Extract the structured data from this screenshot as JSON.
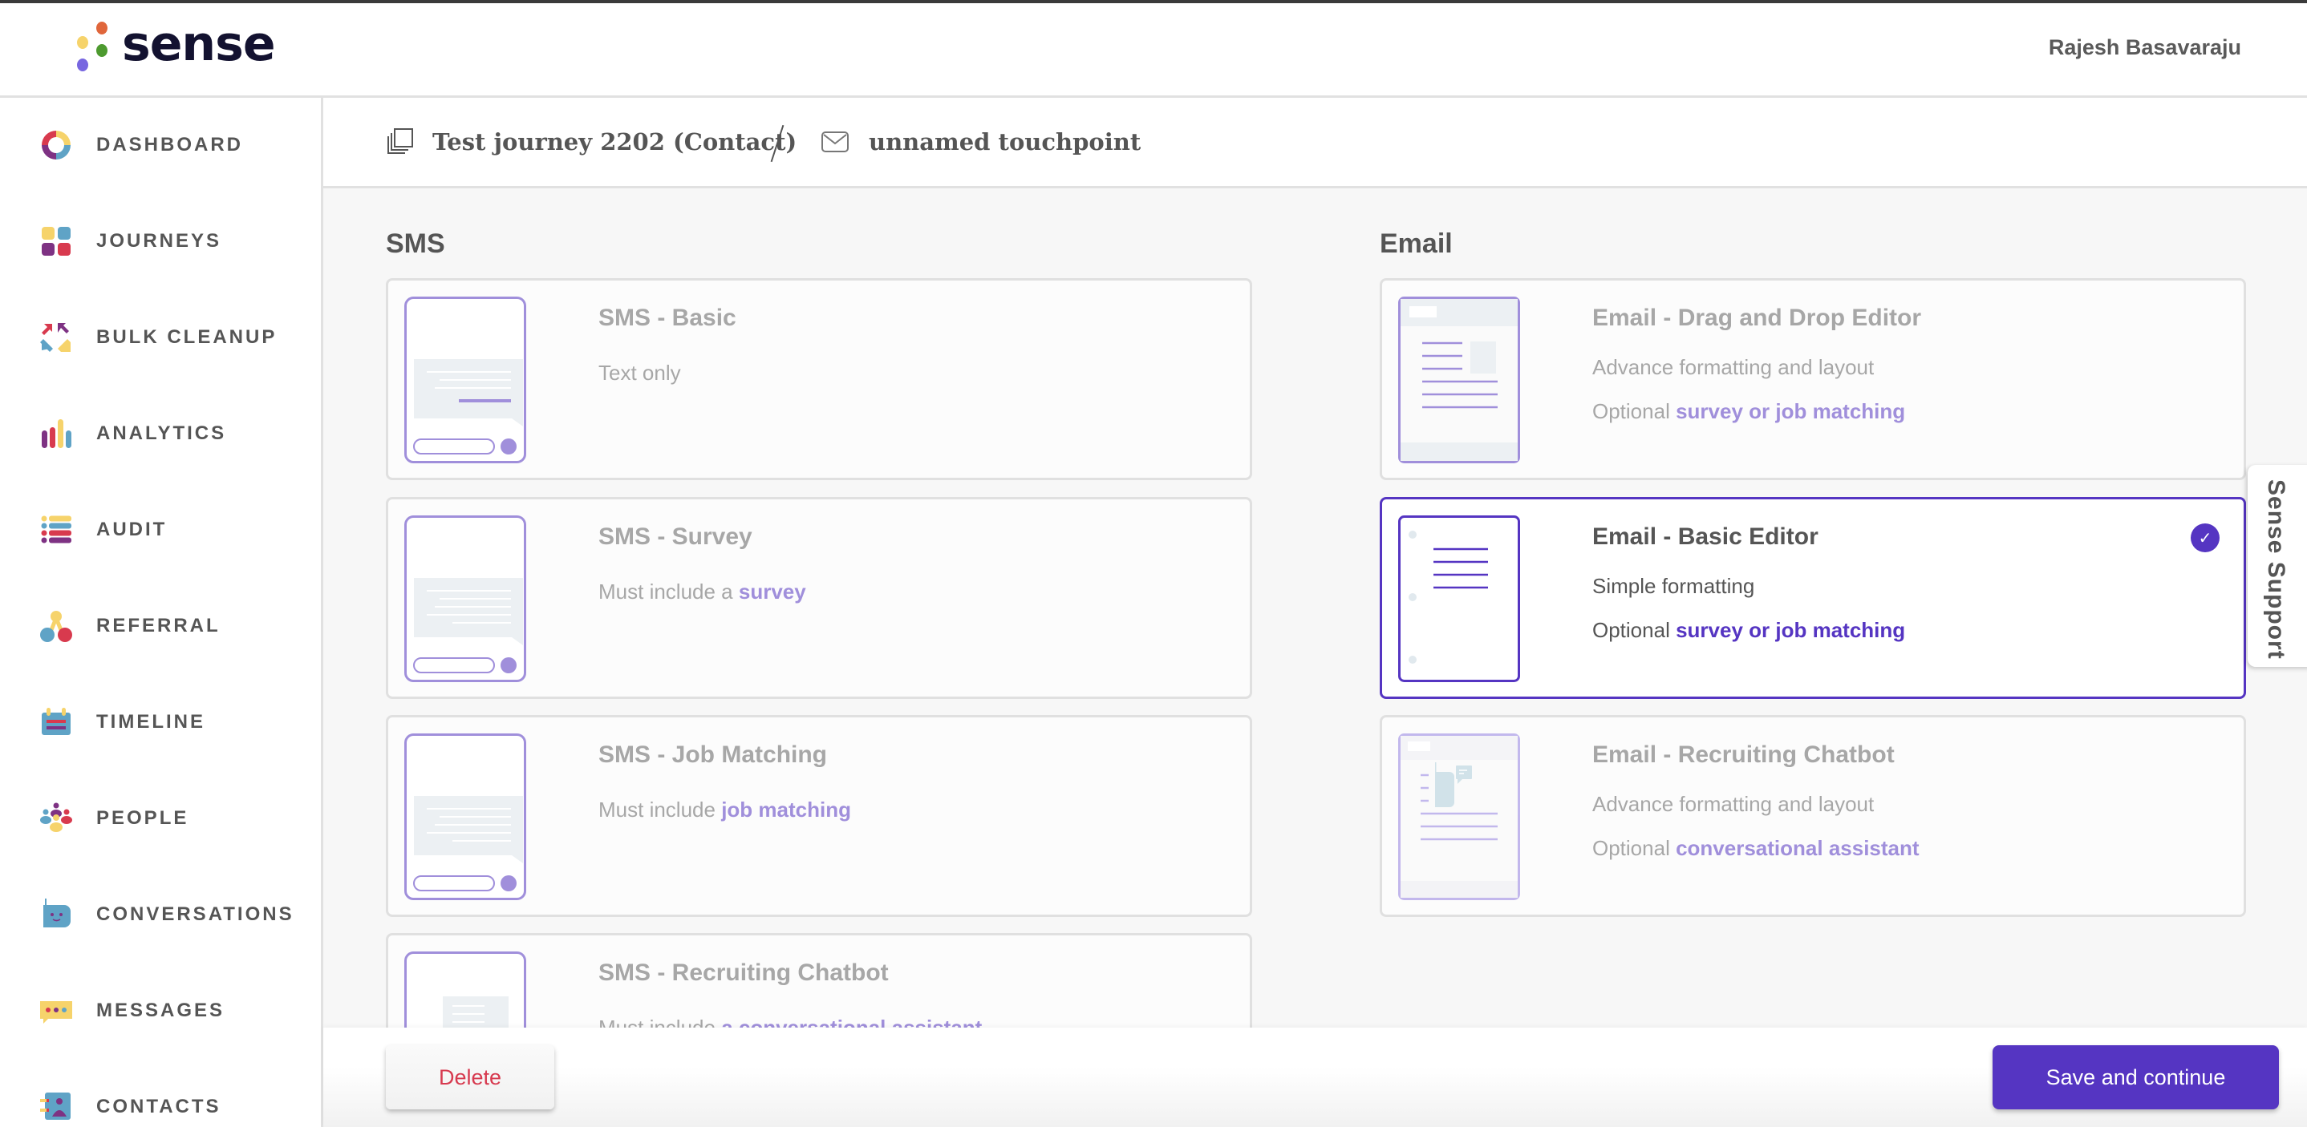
{
  "app": {
    "logo_text": "sense",
    "user_name": "Rajesh Basavaraju",
    "colors": {
      "accent": "#5535c2",
      "accent_light": "#a08fdb",
      "danger": "#d73a4f",
      "brand_yellow": "#f6d36b",
      "brand_blue": "#5fa3c6",
      "brand_red": "#d83a4e",
      "brand_purple": "#7e3283",
      "brand_orange": "#e0663b",
      "brand_green": "#4d9a2f",
      "brand_violet": "#7766e0"
    }
  },
  "sidebar": {
    "items": [
      {
        "label": "DASHBOARD",
        "icon": "dashboard-ring-icon"
      },
      {
        "label": "JOURNEYS",
        "icon": "journeys-grid-icon"
      },
      {
        "label": "BULK CLEANUP",
        "icon": "bulk-cleanup-arrows-icon"
      },
      {
        "label": "ANALYTICS",
        "icon": "analytics-bars-icon"
      },
      {
        "label": "AUDIT",
        "icon": "audit-list-icon"
      },
      {
        "label": "REFERRAL",
        "icon": "referral-nodes-icon"
      },
      {
        "label": "TIMELINE",
        "icon": "timeline-calendar-icon"
      },
      {
        "label": "PEOPLE",
        "icon": "people-group-icon"
      },
      {
        "label": "CONVERSATIONS",
        "icon": "conversations-bot-icon"
      },
      {
        "label": "MESSAGES",
        "icon": "messages-bubble-icon"
      },
      {
        "label": "CONTACTS",
        "icon": "contacts-card-icon"
      }
    ]
  },
  "breadcrumb": {
    "journey": "Test journey 2202 (Contact)",
    "journey_icon": "copy-stack-icon",
    "touchpoint": "unnamed touchpoint",
    "touchpoint_icon": "envelope-icon"
  },
  "sms": {
    "title": "SMS",
    "cards": [
      {
        "title": "SMS - Basic",
        "lines": [
          {
            "text": "Text only",
            "highlight": ""
          }
        ],
        "selected": false
      },
      {
        "title": "SMS - Survey",
        "lines": [
          {
            "text": "Must include a ",
            "highlight": "survey"
          }
        ],
        "selected": false
      },
      {
        "title": "SMS - Job Matching",
        "lines": [
          {
            "text": "Must include ",
            "highlight": "job matching"
          }
        ],
        "selected": false
      },
      {
        "title": "SMS - Recruiting Chatbot",
        "lines": [
          {
            "text": "Must include ",
            "highlight": "a conversational assistant"
          }
        ],
        "selected": false
      }
    ]
  },
  "email": {
    "title": "Email",
    "cards": [
      {
        "title": "Email - Drag and Drop Editor",
        "lines": [
          {
            "text": "Advance formatting and layout",
            "highlight": ""
          },
          {
            "text": "Optional ",
            "highlight": "survey or job matching"
          }
        ],
        "selected": false
      },
      {
        "title": "Email - Basic Editor",
        "lines": [
          {
            "text": "Simple formatting",
            "highlight": ""
          },
          {
            "text": "Optional ",
            "highlight": "survey or job matching"
          }
        ],
        "selected": true
      },
      {
        "title": "Email - Recruiting Chatbot",
        "lines": [
          {
            "text": "Advance formatting and layout",
            "highlight": ""
          },
          {
            "text": "Optional ",
            "highlight": "conversational assistant"
          }
        ],
        "selected": false
      }
    ]
  },
  "footer": {
    "delete_label": "Delete",
    "save_label": "Save and continue"
  },
  "support": {
    "label": "Sense Support"
  },
  "icons": {
    "check": "✓"
  }
}
